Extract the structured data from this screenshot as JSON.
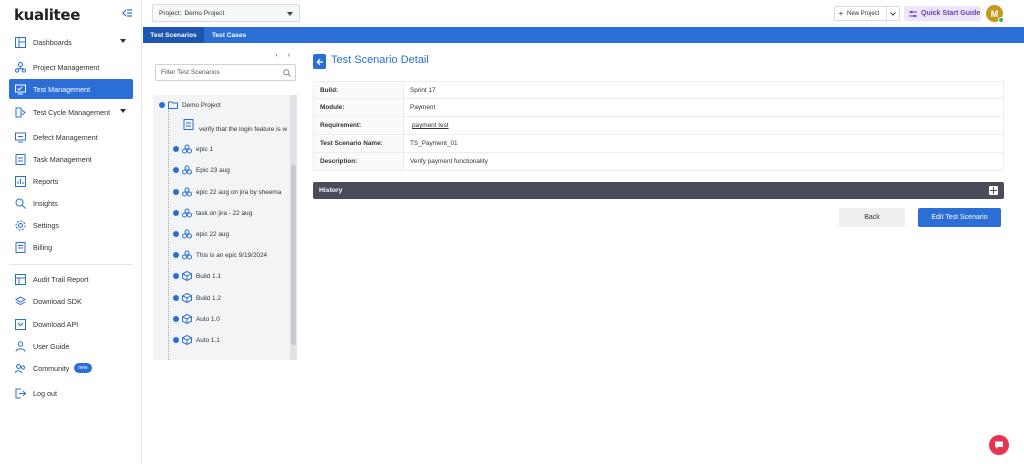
{
  "brand": {
    "logo": "kualitee"
  },
  "sidebar": {
    "items": [
      {
        "label": "Dashboards",
        "icon": "dashboard-icon"
      },
      {
        "label": "Project Management",
        "icon": "project-icon"
      },
      {
        "label": "Test Management",
        "icon": "test-management-icon"
      },
      {
        "label": "Test Cycle Management",
        "icon": "test-cycle-icon"
      },
      {
        "label": "Defect Management",
        "icon": "defect-icon"
      },
      {
        "label": "Task Management",
        "icon": "task-icon"
      },
      {
        "label": "Reports",
        "icon": "reports-icon"
      },
      {
        "label": "Insights",
        "icon": "insights-icon"
      },
      {
        "label": "Settings",
        "icon": "settings-icon"
      },
      {
        "label": "Billing",
        "icon": "billing-icon"
      },
      {
        "label": "Audit Trail Report",
        "icon": "audit-icon"
      },
      {
        "label": "Download SDK",
        "icon": "sdk-icon"
      },
      {
        "label": "Download API",
        "icon": "api-icon"
      },
      {
        "label": "User Guide",
        "icon": "user-guide-icon"
      },
      {
        "label": "Community",
        "icon": "community-icon",
        "badge": "new"
      },
      {
        "label": "Log out",
        "icon": "logout-icon"
      }
    ],
    "active_index": 2
  },
  "topbar": {
    "project_label": "Project:",
    "project_value": "Demo Project",
    "new_project_label": "New Project",
    "quick_start_label": "Quick Start Guide",
    "avatar_initial": "M"
  },
  "tabs": [
    {
      "label": "Test Scenarios",
      "active": true
    },
    {
      "label": "Test Cases",
      "active": false
    }
  ],
  "tree": {
    "search_placeholder": "Filter Test Scenarios",
    "root": "Demo Project",
    "nodes": [
      {
        "label": "verify that the login feature is w",
        "type": "scenario"
      },
      {
        "label": "epic 1",
        "type": "epic"
      },
      {
        "label": "Epic 23 aug",
        "type": "epic"
      },
      {
        "label": "epic 22 aug on jira by sheema",
        "type": "epic"
      },
      {
        "label": "task on jira - 22 aug",
        "type": "epic"
      },
      {
        "label": "epic 22 aug",
        "type": "epic"
      },
      {
        "label": "This is an epic 9/19/2024",
        "type": "epic"
      },
      {
        "label": "Build 1.1",
        "type": "build"
      },
      {
        "label": "Build 1.2",
        "type": "build"
      },
      {
        "label": "Auto 1.0",
        "type": "build"
      },
      {
        "label": "Auto 1.1",
        "type": "build"
      }
    ]
  },
  "detail": {
    "title": "Test Scenario Detail",
    "rows": [
      {
        "key": "Build:",
        "value": "Sprint 17"
      },
      {
        "key": "Module:",
        "value": "Payment"
      },
      {
        "key": "Requirement:",
        "value": "payment test"
      },
      {
        "key": "Test Scenario Name:",
        "value": "TS_Payment_01"
      },
      {
        "key": "Description:",
        "value": "Verify payment functionality"
      }
    ],
    "history_label": "History",
    "back_label": "Back",
    "edit_label": "Edit Test Scenario"
  },
  "colors": {
    "accent": "#2b6fd6",
    "history_bar": "#4a4c5a",
    "chat": "#e8344e",
    "quick_start_bg": "#ece6f8"
  }
}
